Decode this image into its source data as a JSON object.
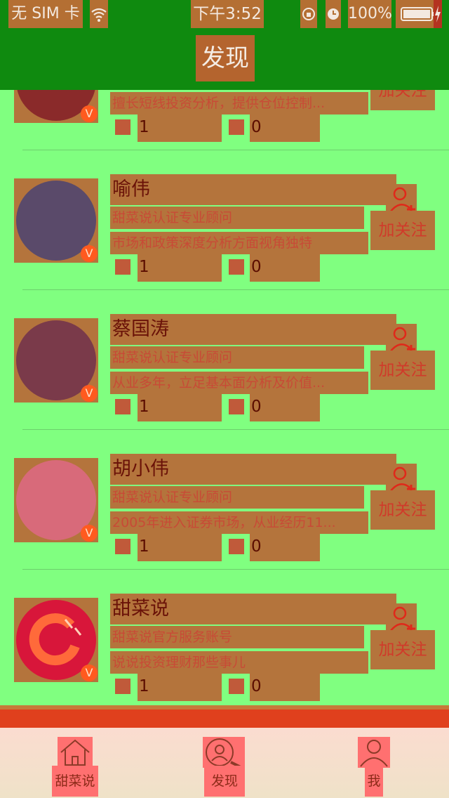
{
  "status_bar": {
    "carrier": "无 SIM 卡",
    "time": "下午3:52",
    "battery": "100%"
  },
  "nav": {
    "title": "发现"
  },
  "users": [
    {
      "name": "",
      "title": "",
      "desc": "擅长短线投资分析，提供仓位控制...",
      "fans": "1",
      "likes": "0",
      "follow": "加关注",
      "avatar_color": "#8a2a2a"
    },
    {
      "name": "喻伟",
      "title": "甜菜说认证专业顾问",
      "desc": "市场和政策深度分析方面视角独特",
      "fans": "1",
      "likes": "0",
      "follow": "加关注",
      "avatar_color": "#5a4a6a"
    },
    {
      "name": "蔡国涛",
      "title": "甜菜说认证专业顾问",
      "desc": "从业多年，立足基本面分析及价值...",
      "fans": "1",
      "likes": "0",
      "follow": "加关注",
      "avatar_color": "#7a3a4a"
    },
    {
      "name": "胡小伟",
      "title": "甜菜说认证专业顾问",
      "desc": "2005年进入证券市场，从业经历11...",
      "fans": "1",
      "likes": "0",
      "follow": "加关注",
      "avatar_color": "#d86a7a"
    },
    {
      "name": "甜菜说",
      "title": "甜菜说官方服务账号",
      "desc": "说说投资理财那些事儿",
      "fans": "1",
      "likes": "0",
      "follow": "加关注",
      "avatar_color": "#d8163a"
    }
  ],
  "tabs": [
    {
      "label": "甜菜说",
      "icon": "home-icon"
    },
    {
      "label": "发现",
      "icon": "discover-icon"
    },
    {
      "label": "我",
      "icon": "profile-icon"
    }
  ]
}
